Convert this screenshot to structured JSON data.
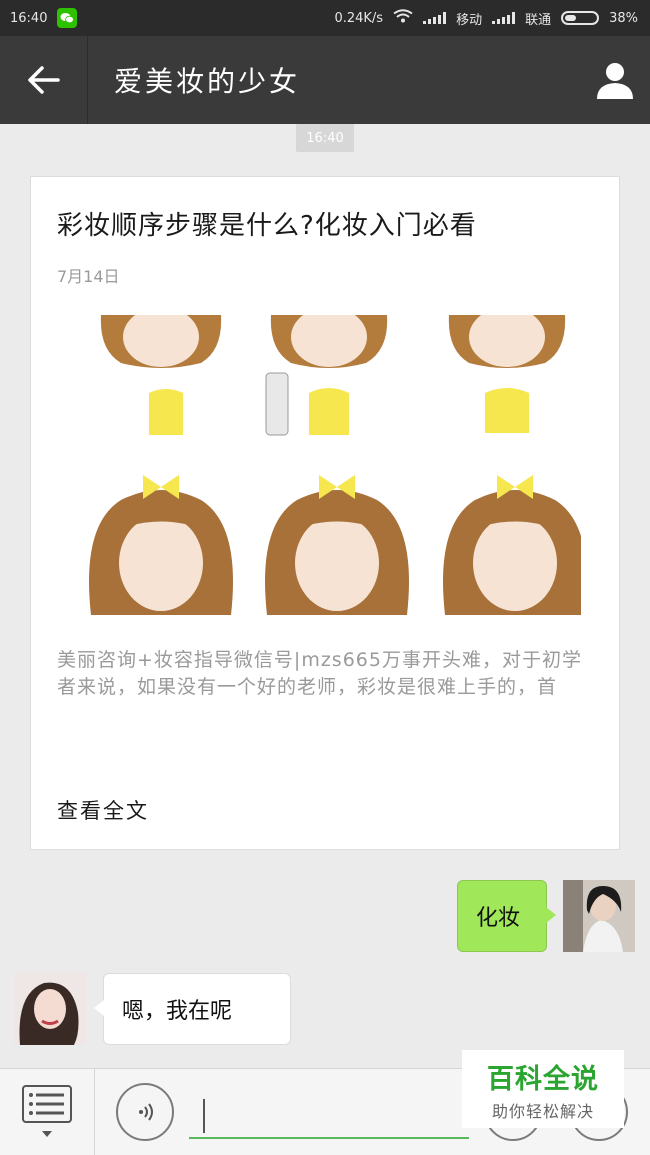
{
  "status_bar": {
    "time": "16:40",
    "network_speed": "0.24K/s",
    "carrier1": "移动",
    "carrier2": "联通",
    "battery": "38%",
    "battery_level": 0.38
  },
  "header": {
    "title": "爱美妆的少女"
  },
  "chat": {
    "timestamp": "16:40",
    "article": {
      "title": "彩妆顺序步骤是什么?化妆入门必看",
      "date": "7月14日",
      "summary": "美丽咨询+妆容指导微信号|mzs665万事开头难，对于初学者来说，如果没有一个好的老师，彩妆是很难上手的，首",
      "read_more": "查看全文"
    },
    "messages": [
      {
        "side": "right",
        "text": "化妆"
      },
      {
        "side": "left",
        "text": "嗯，我在呢"
      }
    ]
  },
  "watermark": {
    "main": "百科全说",
    "sub": "助你轻松解决"
  },
  "colors": {
    "status_bar_bg": "#2b2b2b",
    "title_bar_bg": "#3a3a3a",
    "chat_bg": "#ebebeb",
    "sent_bubble": "#a0e75a",
    "watermark_green": "#2aa52f"
  }
}
